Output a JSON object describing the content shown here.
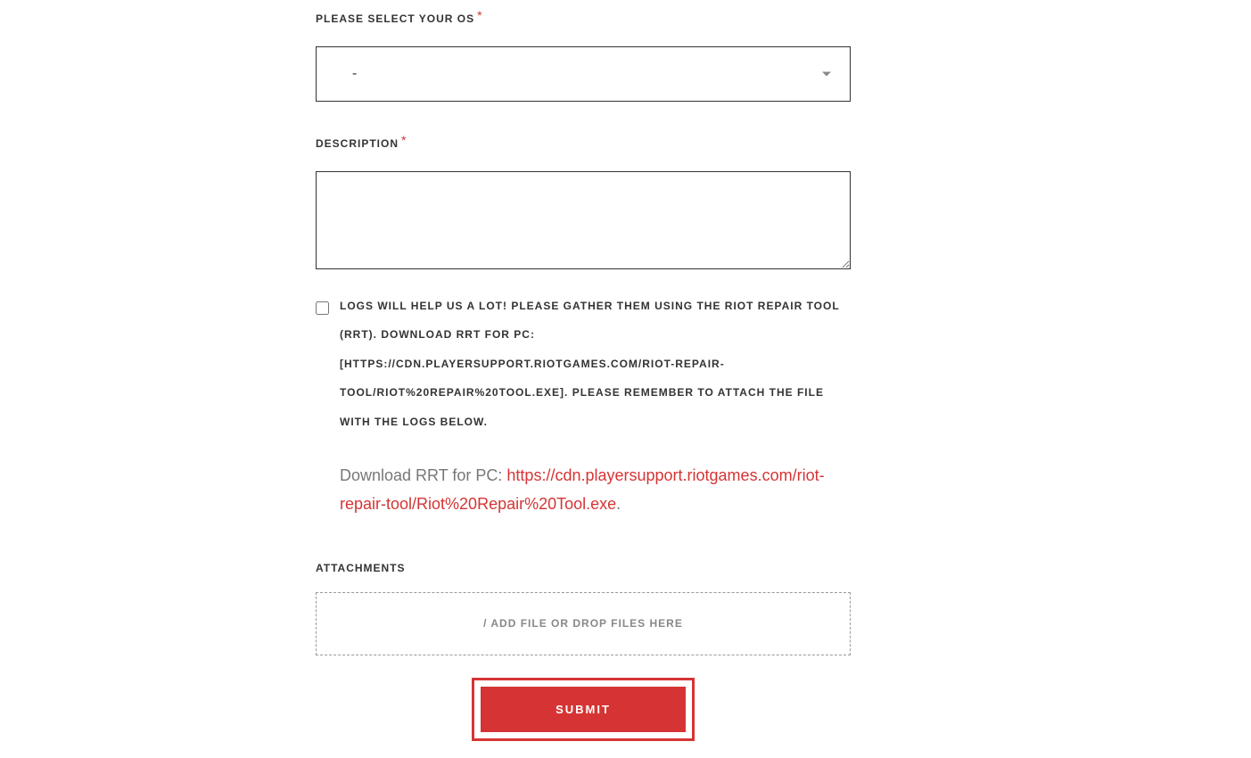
{
  "os_select": {
    "label": "PLEASE SELECT YOUR OS",
    "value": "-"
  },
  "description": {
    "label": "DESCRIPTION",
    "value": ""
  },
  "logs_checkbox": {
    "label": "LOGS WILL HELP US A LOT! PLEASE GATHER THEM USING THE RIOT REPAIR TOOL (RRT). DOWNLOAD RRT FOR PC: [HTTPS://CDN.PLAYERSUPPORT.RIOTGAMES.COM/RIOT-REPAIR-TOOL/RIOT%20REPAIR%20TOOL.EXE]. PLEASE REMEMBER TO ATTACH THE FILE WITH THE LOGS BELOW.",
    "help_text": "Download RRT for PC: ",
    "link_text": "https://cdn.playersupport.riotgames.com/riot-repair-tool/Riot%20Repair%20Tool.exe",
    "period": "."
  },
  "attachments": {
    "label": "ATTACHMENTS",
    "dropzone_text": "/ ADD FILE OR DROP FILES HERE"
  },
  "submit": {
    "label": "SUBMIT"
  }
}
